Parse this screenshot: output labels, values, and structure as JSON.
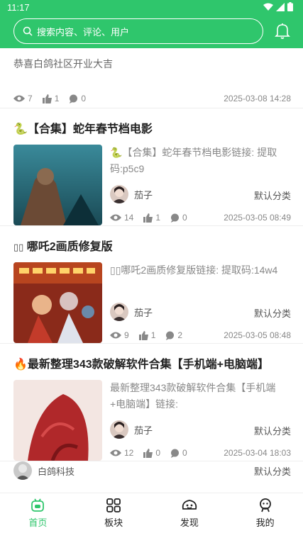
{
  "status_bar": {
    "time": "11:17"
  },
  "header": {
    "search_placeholder": "搜索内容、评论、用户"
  },
  "colors": {
    "brand": "#2fc66c"
  },
  "top_post": {
    "text": "恭喜白鸽社区开业大吉",
    "views": "7",
    "likes": "1",
    "comments": "0",
    "date": "2025-03-08 14:28"
  },
  "posts": [
    {
      "title_icon": "🐍",
      "title": "【合集】蛇年春节档电影",
      "excerpt": "🐍【合集】蛇年春节档电影链接: 提取码:p5c9",
      "author": "茄子",
      "category": "默认分类",
      "views": "14",
      "likes": "1",
      "comments": "0",
      "date": "2025-03-05 08:49"
    },
    {
      "title_icon": "▯▯",
      "title": " 哪吒2画质修复版",
      "excerpt": "▯▯哪吒2画质修复版链接: 提取码:14w4",
      "author": "茄子",
      "category": "默认分类",
      "views": "9",
      "likes": "1",
      "comments": "2",
      "date": "2025-03-05 08:48"
    },
    {
      "title_icon": "🔥",
      "title": "最新整理343款破解软件合集【手机端+电脑端】",
      "excerpt": "最新整理343款破解软件合集【手机端+电脑端】链接:",
      "author": "茄子",
      "category": "默认分类",
      "views": "12",
      "likes": "0",
      "comments": "0",
      "date": "2025-03-04 18:03"
    }
  ],
  "partial_post": {
    "author": "白鸽科技",
    "category": "默认分类"
  },
  "tabbar": {
    "home": "首页",
    "boards": "板块",
    "discover": "发现",
    "mine": "我的"
  }
}
